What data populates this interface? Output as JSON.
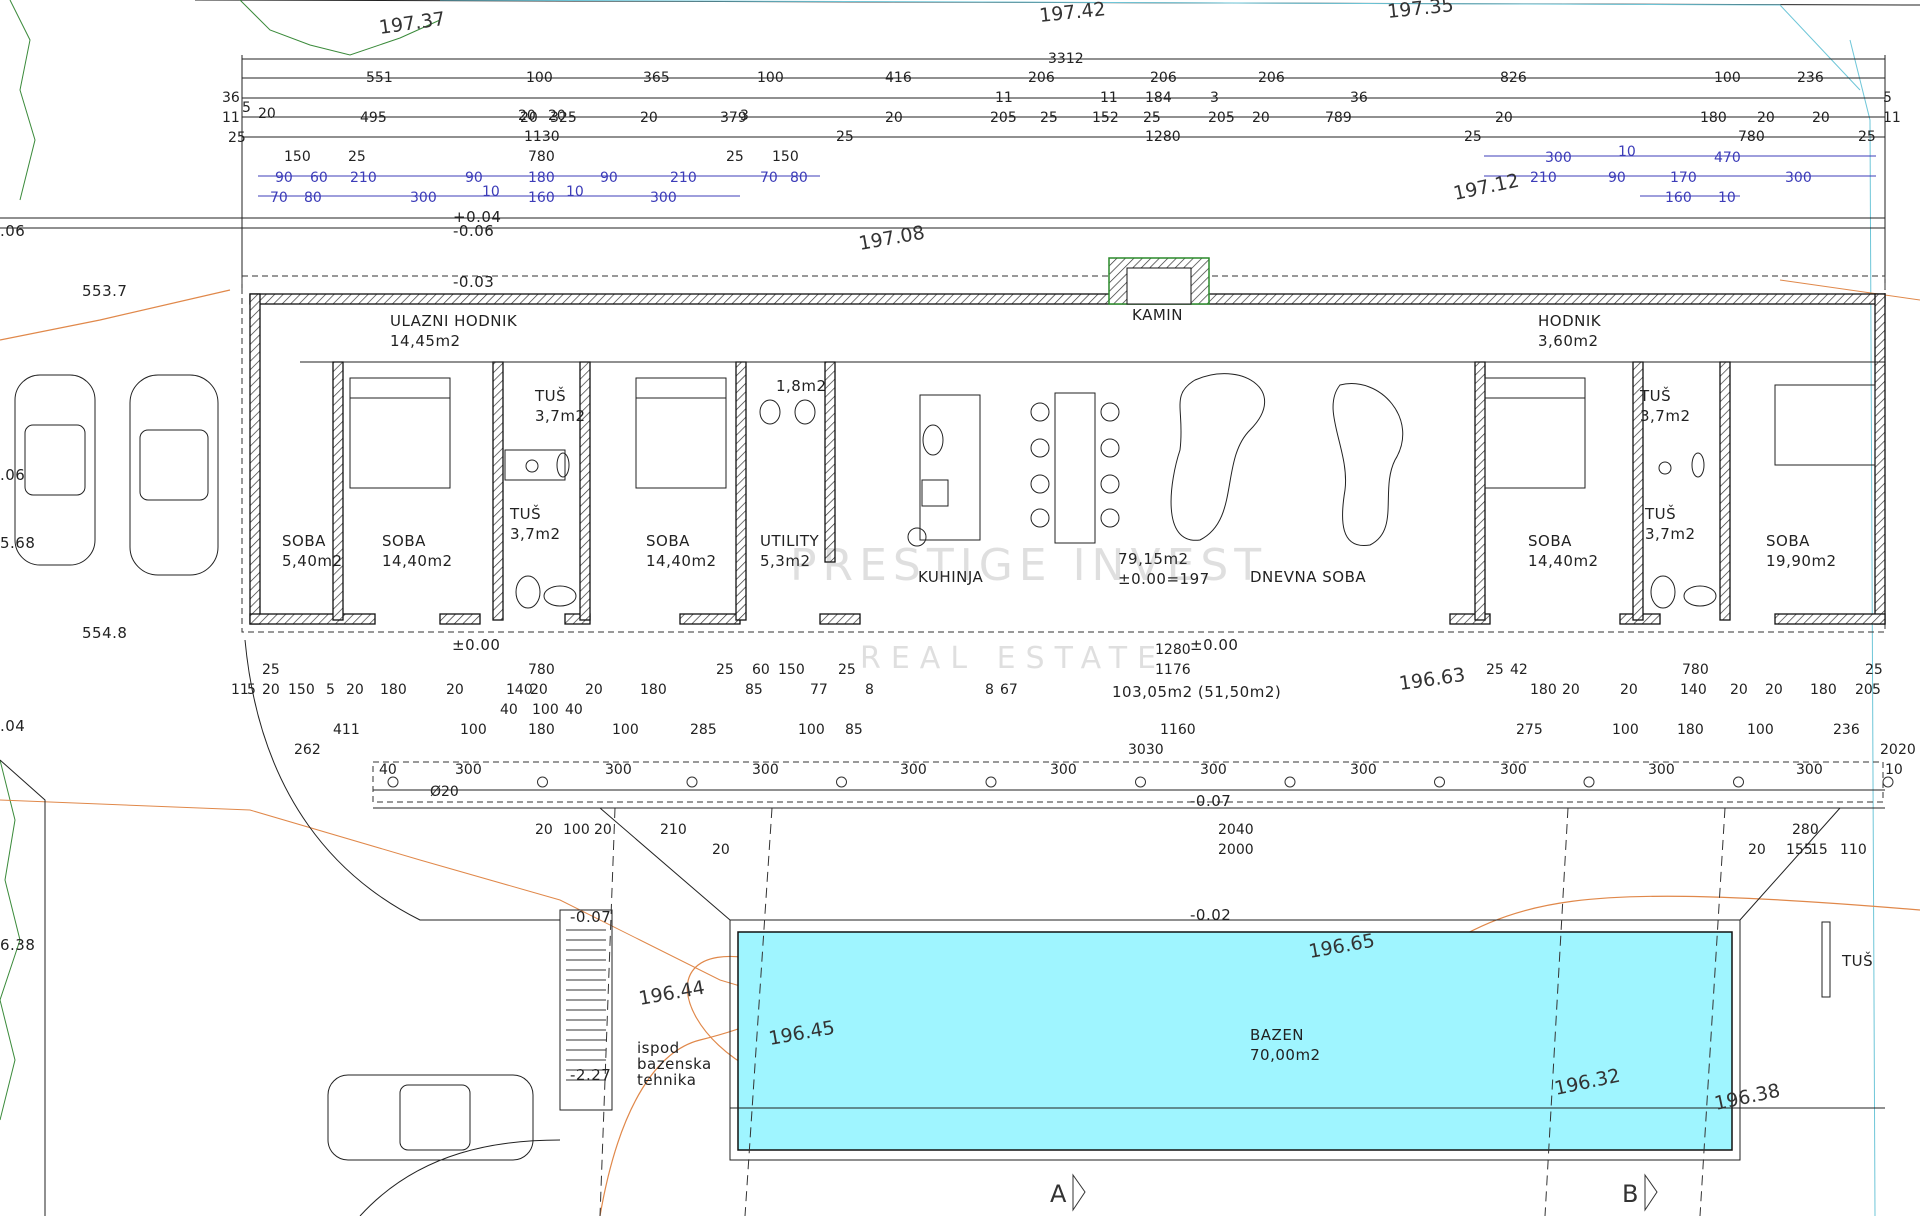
{
  "rooms": [
    {
      "name": "ULAZNI HODNIK",
      "area": "14,45m2"
    },
    {
      "name": "SOBA",
      "area": "5,40m2"
    },
    {
      "name": "SOBA",
      "area": "14,40m2"
    },
    {
      "name": "TUŠ",
      "area": "3,7m2"
    },
    {
      "name": "TUŠ",
      "area": "3,7m2"
    },
    {
      "name": "SOBA",
      "area": "14,40m2"
    },
    {
      "name": "UTILITY",
      "area": "5,3m2"
    },
    {
      "name": "",
      "area": "1,8m2"
    },
    {
      "name": "KUHINJA",
      "area": ""
    },
    {
      "name": "",
      "area": "79,15m2"
    },
    {
      "name": "DNEVNA SOBA",
      "area": ""
    },
    {
      "name": "KAMIN",
      "area": ""
    },
    {
      "name": "HODNIK",
      "area": "3,60m2"
    },
    {
      "name": "SOBA",
      "area": "14,40m2"
    },
    {
      "name": "TUŠ",
      "area": "3,7m2"
    },
    {
      "name": "TUŠ",
      "area": "3,7m2"
    },
    {
      "name": "SOBA",
      "area": "19,90m2"
    },
    {
      "name": "BAZEN",
      "area": "70,00m2"
    },
    {
      "name": "TUŠ",
      "area": ""
    }
  ],
  "level_note": "±0.00=197",
  "ground_area": "103,05m2 (51,50m2)",
  "elevations": [
    "197.37",
    "197.42",
    "197.35",
    "197.12",
    "197.08",
    "196.63",
    "196.65",
    "196.44",
    "196.45",
    "196.32",
    "196.38"
  ],
  "levels": [
    "+0.04",
    "-0.06",
    "-0.03",
    "±0.00",
    "±0.00",
    "-0.07",
    "-0.02",
    "-0.07",
    "-2.27"
  ],
  "edge_values": [
    "553.7",
    "554.8",
    ".06",
    ".06",
    "5.68",
    ".04",
    "6.38"
  ],
  "tech_room": [
    "ispod",
    "bazenska",
    "tehnika"
  ],
  "section_marks": [
    "A",
    "B"
  ],
  "pillar_note": "Ø20",
  "watermark": "PRESTIGE INVEST",
  "watermark_sub": "REAL ESTATE",
  "dims_top": {
    "overall": "3312",
    "row1": [
      "551",
      "100",
      "365",
      "100",
      "416",
      "206",
      "206",
      "206",
      "826",
      "100",
      "236"
    ],
    "row1b": [
      "184"
    ],
    "row2": [
      "495",
      "20",
      "325",
      "20",
      "379",
      "20",
      "205",
      "25",
      "152",
      "25",
      "205",
      "20",
      "789",
      "20",
      "180",
      "20",
      "20"
    ],
    "row2_small": [
      "36",
      "11",
      "25",
      "5",
      "20",
      "20",
      "20",
      "3",
      "11",
      "11",
      "3",
      "36",
      "5",
      "11"
    ],
    "row3": [
      "1130",
      "25",
      "1280",
      "25",
      "780",
      "25"
    ],
    "row4": [
      "150",
      "25",
      "780",
      "25",
      "150"
    ]
  },
  "dims_blue_left": [
    "90",
    "60",
    "70",
    "80",
    "210",
    "90",
    "180",
    "90",
    "210",
    "300",
    "10",
    "160",
    "10",
    "300",
    "70",
    "80"
  ],
  "dims_blue_right": [
    "300",
    "10",
    "470",
    "210",
    "90",
    "170",
    "300",
    "160",
    "10"
  ],
  "dims_bottom": {
    "r1": [
      "25",
      "780",
      "25",
      "60",
      "25",
      "150",
      "1280",
      "1176",
      "42",
      "25",
      "780",
      "25"
    ],
    "r2": [
      "11",
      "5",
      "20",
      "150",
      "5",
      "20",
      "180",
      "20",
      "140",
      "20",
      "20",
      "180",
      "85",
      "77",
      "8",
      "8",
      "67",
      "180",
      "20",
      "20",
      "140",
      "20",
      "20",
      "180",
      "20",
      "5"
    ],
    "r2b": [
      "40",
      "100",
      "40"
    ],
    "r3": [
      "411",
      "100",
      "180",
      "100",
      "285",
      "100",
      "85",
      "1160",
      "275",
      "100",
      "180",
      "100",
      "236"
    ],
    "r4": [
      "262",
      "3030",
      "20",
      "20"
    ],
    "r5": [
      "40",
      "300",
      "300",
      "300",
      "300",
      "300",
      "300",
      "300",
      "300",
      "300",
      "300",
      "10"
    ],
    "r6": [
      "20",
      "100",
      "20",
      "210",
      "2040",
      "280",
      "20",
      "2000",
      "20",
      "155",
      "15",
      "110"
    ]
  }
}
